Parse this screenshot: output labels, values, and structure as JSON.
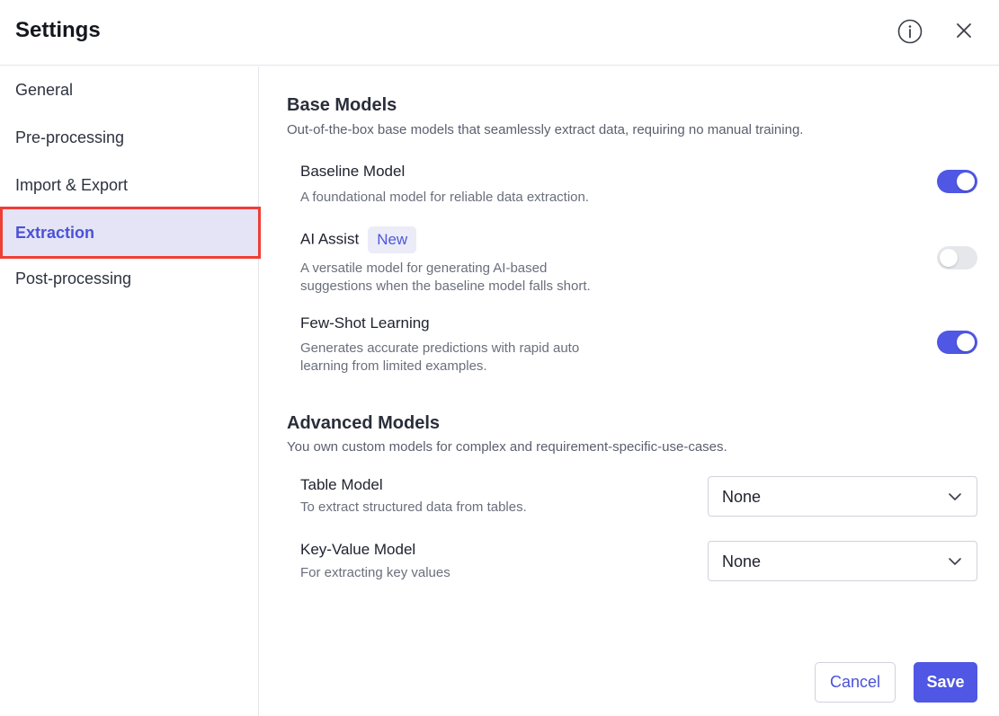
{
  "header": {
    "title": "Settings",
    "info_icon": "info-circle-icon",
    "close_icon": "close-icon"
  },
  "sidebar": {
    "items": [
      {
        "label": "General",
        "active": false
      },
      {
        "label": "Pre-processing",
        "active": false
      },
      {
        "label": "Import & Export",
        "active": false
      },
      {
        "label": "Extraction",
        "active": true
      },
      {
        "label": "Post-processing",
        "active": false
      }
    ]
  },
  "base_models": {
    "title": "Base Models",
    "description": "Out-of-the-box base models that seamlessly extract data, requiring no manual training.",
    "options": [
      {
        "title": "Baseline Model",
        "description": "A foundational model for reliable data extraction.",
        "enabled": true
      },
      {
        "title": "AI Assist",
        "badge": "New",
        "description_lines": [
          "A versatile model for generating AI-based",
          "suggestions when the baseline model falls short."
        ],
        "enabled": false
      },
      {
        "title": "Few-Shot Learning",
        "description_lines": [
          "Generates accurate predictions with rapid auto",
          "learning from limited examples."
        ],
        "enabled": true
      }
    ]
  },
  "advanced_models": {
    "title": "Advanced Models",
    "description": "You own custom models for complex and requirement-specific-use-cases.",
    "options": [
      {
        "title": "Table Model",
        "description": "To extract structured data from tables.",
        "selected": "None"
      },
      {
        "title": "Key-Value Model",
        "description": "For extracting key values",
        "selected": "None"
      }
    ]
  },
  "footer": {
    "cancel_label": "Cancel",
    "save_label": "Save"
  },
  "colors": {
    "accent": "#4f57e4",
    "active_nav_bg": "#e4e4f6",
    "highlight_outline": "#ef3f35"
  }
}
